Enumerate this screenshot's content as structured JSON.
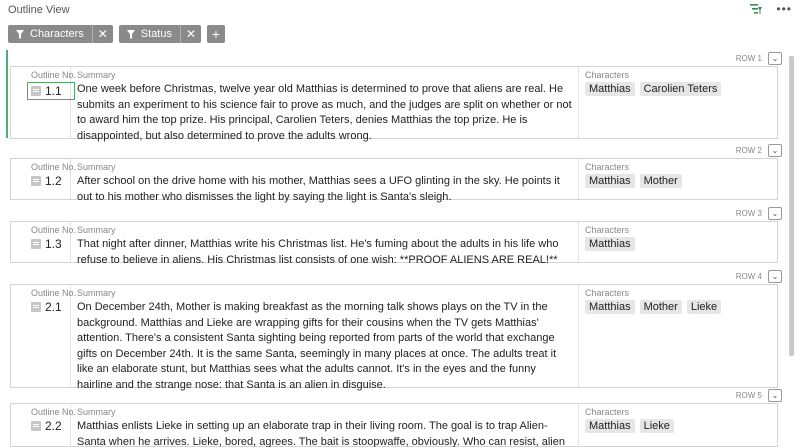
{
  "header": {
    "title": "Outline View",
    "filter_icon": "filter-icon",
    "more_icon": "more-icon"
  },
  "filters": [
    {
      "label": "Characters"
    },
    {
      "label": "Status"
    }
  ],
  "add_filter": "+",
  "labels": {
    "outline_no": "Outline No.",
    "summary": "Summary",
    "characters": "Characters"
  },
  "colors": {
    "accent": "#4caf73",
    "chip": "#8a8a8a"
  },
  "rows": [
    {
      "row_label": "ROW 1",
      "no": "1.1",
      "summary": "One week before Christmas, twelve year old Matthias is determined to prove that aliens are real. He submits an experiment to his science fair to prove as much, and the judges are split on whether or not to award him the top prize. His principal, Carolien Teters, denies Matthias the top prize. He is disappointed, but also determined to prove the adults wrong.",
      "characters": [
        "Matthias",
        "Carolien Teters"
      ]
    },
    {
      "row_label": "ROW 2",
      "no": "1.2",
      "summary": "After school on the drive home with his mother, Matthias sees a UFO glinting in the sky. He points it out to his mother who dismisses the light by saying the light is Santa's sleigh.",
      "characters": [
        "Matthias",
        "Mother"
      ]
    },
    {
      "row_label": "ROW 3",
      "no": "1.3",
      "summary": "That night after dinner, Matthias write his Christmas list. He's fuming about the adults in his life who refuse to believe in aliens. His Christmas list consists of one wish: **PROOF ALIENS ARE REAL!**",
      "characters": [
        "Matthias"
      ]
    },
    {
      "row_label": "ROW 4",
      "no": "2.1",
      "summary": "On December 24th, Mother is making breakfast as the morning talk shows plays on the TV in the background. Matthias and Lieke are wrapping gifts for their cousins when the TV gets Matthias' attention. There's a consistent Santa sighting being reported from parts of the world that exchange gifts on December 24th. It is the same Santa, seemingly in many places at once. The adults treat it like an elaborate stunt, but Matthias sees what the adults cannot. It's in the eyes and the funny hairline and the strange nose: that Santa is an alien in disguise.",
      "characters": [
        "Matthias",
        "Mother",
        "Lieke"
      ]
    },
    {
      "row_label": "ROW 5",
      "no": "2.2",
      "summary": "Matthias enlists Lieke in setting up an elaborate trap in their living room. The goal is to trap Alien-Santa when he arrives. Lieke, bored, agrees. The bait is stoopwaffe, obviously. Who can resist, alien or not?",
      "characters": [
        "Matthias",
        "Lieke"
      ]
    }
  ]
}
